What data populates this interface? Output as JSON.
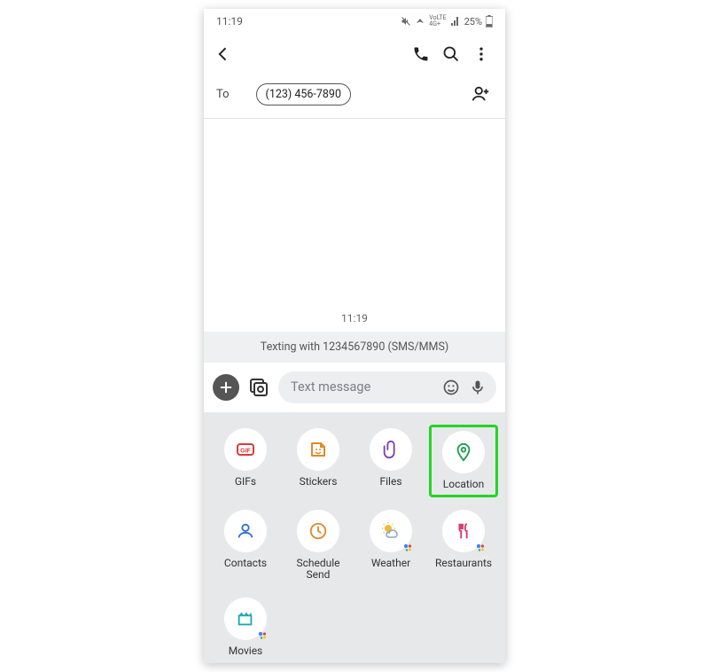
{
  "status": {
    "time": "11:19",
    "battery": "25%"
  },
  "appbar": {},
  "recipient": {
    "to_label": "To",
    "phone_chip": "(123) 456-7890"
  },
  "conversation": {
    "timestamp": "11:19",
    "info_text": "Texting with 1234567890 (SMS/MMS)"
  },
  "composer": {
    "placeholder": "Text message"
  },
  "attachments": {
    "gifs": "GIFs",
    "stickers": "Stickers",
    "files": "Files",
    "location": "Location",
    "contacts": "Contacts",
    "schedule": "Schedule Send",
    "weather": "Weather",
    "restaurants": "Restaurants",
    "movies": "Movies"
  },
  "highlight_color": "#24d424"
}
